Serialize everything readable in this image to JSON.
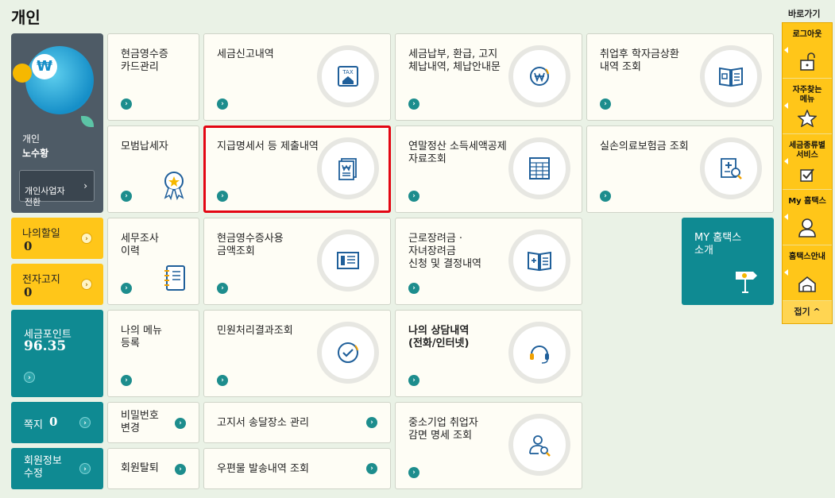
{
  "page_title": "개인",
  "profile": {
    "user_type": "개인",
    "user_name": "노수황",
    "switch_button": "개인사업자\n전환",
    "coin_symbol": "₩"
  },
  "left_boxes": {
    "todo_label": "나의할일",
    "todo_count": "0",
    "notice_label": "전자고지",
    "notice_count": "0",
    "points_label": "세금포인트",
    "points_value": "96.35",
    "message_label": "쪽지",
    "message_count": "0",
    "member_edit": "회원정보\n수정"
  },
  "cards": {
    "cash_receipt_card": "현금영수증\n카드관리",
    "tax_report": "세금신고내역",
    "tax_payment": "세금납부, 환급, 고지\n체납내역, 체납안내문",
    "student_loan": "취업후 학자금상환\n내역 조회",
    "model_taxpayer": "모범납세자",
    "payment_statement": "지급명세서 등 제출내역",
    "year_end": "연말정산 소득세액공제\n자료조회",
    "medical_insurance": "실손의료보험금 조회",
    "tax_audit": "세무조사\n이력",
    "cash_usage": "현금영수증사용\n금액조회",
    "earned_income": "근로장려금 ·\n자녀장려금\n신청 및 결정내역",
    "my_menu": "나의 메뉴\n등록",
    "civil_result": "민원처리결과조회",
    "consultation": "나의 상담내역\n(전화/인터넷)",
    "password_change": "비밀번호\n변경",
    "notice_address": "고지서 송달장소 관리",
    "sme_reduction": "중소기업 취업자\n감면 명세 조회",
    "withdraw": "회원탈퇴",
    "mail_history": "우편물 발송내역 조회",
    "my_hometax_intro": "MY 홈택스\n소개",
    "tax_badge": "TAX"
  },
  "quick_menu": {
    "title": "바로가기",
    "items": [
      "로그아웃",
      "자주찾는\n메뉴",
      "세금종류별\n서비스",
      "My 홈택스",
      "홈택스안내"
    ],
    "close_label": "접기 ^"
  },
  "colors": {
    "teal": "#0f8a92",
    "yellow": "#ffc619",
    "highlight": "#e30613",
    "background": "#eaf2e6"
  }
}
